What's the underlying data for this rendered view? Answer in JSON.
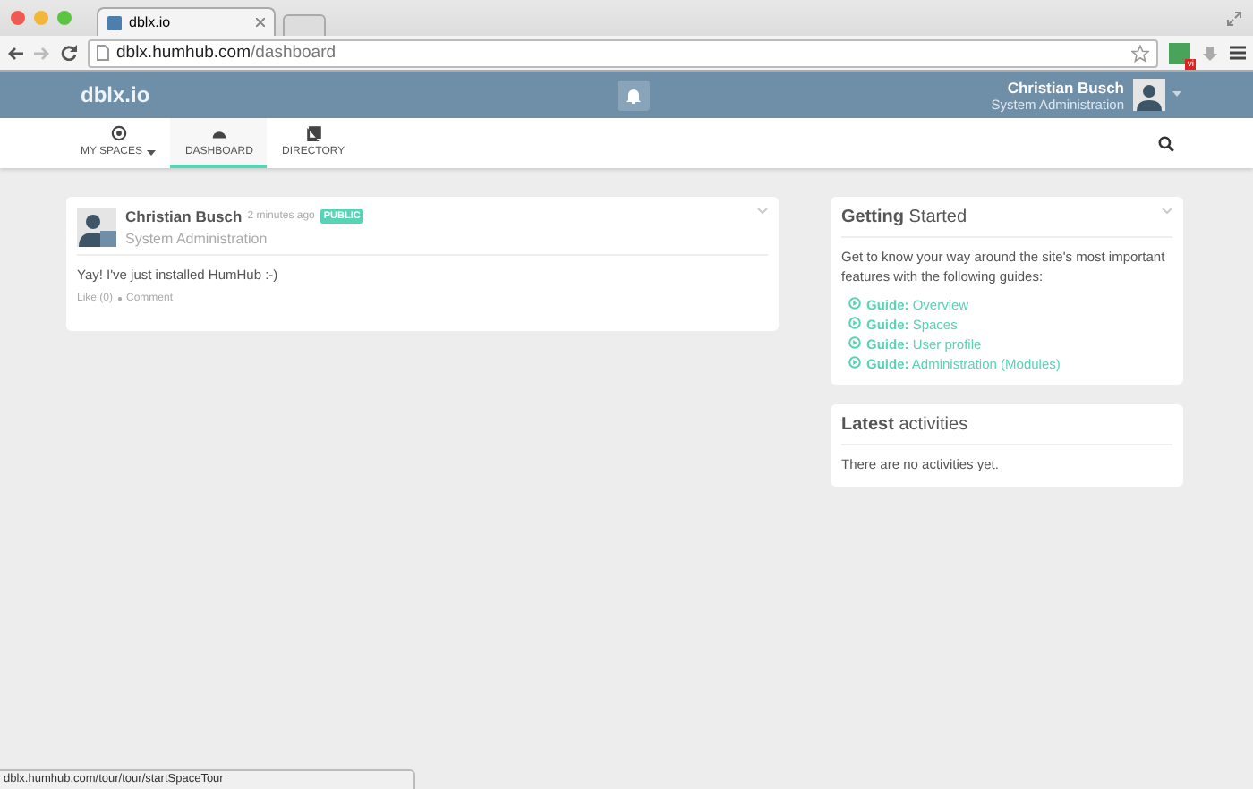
{
  "browser": {
    "tab_title": "dblx.io",
    "url_host": "dblx.humhub.com",
    "url_path": "/dashboard",
    "extension_badge": "vi"
  },
  "top_bar": {
    "site_name": "dblx.io",
    "user_name": "Christian Busch",
    "user_role": "System Administration"
  },
  "nav": [
    {
      "label": "MY SPACES",
      "selected": false,
      "dropdown": true
    },
    {
      "label": "DASHBOARD",
      "selected": true,
      "dropdown": false
    },
    {
      "label": "DIRECTORY",
      "selected": false,
      "dropdown": false
    }
  ],
  "post": {
    "author": "Christian Busch",
    "time": "2 minutes ago",
    "badge": "PUBLIC",
    "space": "System Administration",
    "text": "Yay! I've just installed HumHub :-)",
    "actions": [
      "Like (0)",
      "Comment"
    ]
  },
  "panels": [
    {
      "title": "**Getting** Started",
      "collapsible": true,
      "text": "Get to know your way around the site's most important features with the following guides:",
      "links": [
        "**Guide:** Overview",
        "**Guide:** Spaces",
        "**Guide:** User profile",
        "**Guide:** Administration (Modules)"
      ]
    },
    {
      "title": "**Latest** activities",
      "collapsible": false,
      "text": "There are no activities yet."
    }
  ],
  "status_bar": {
    "url": "dblx.humhub.com/tour/tour/startSpaceTour"
  }
}
